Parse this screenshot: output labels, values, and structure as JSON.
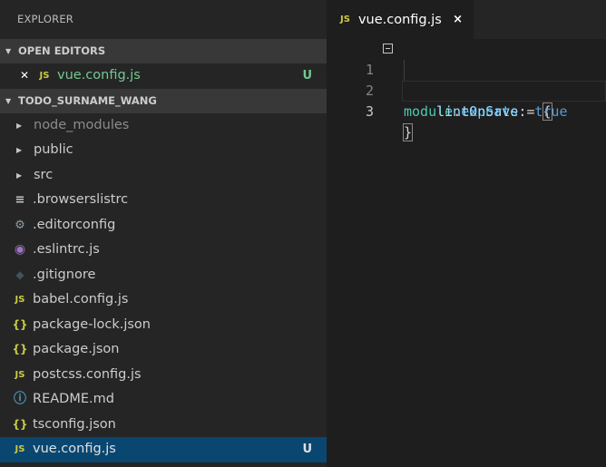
{
  "sidebar": {
    "title": "EXPLORER",
    "open_editors": {
      "label": "OPEN EDITORS",
      "items": [
        {
          "icon": "JS",
          "name": "vue.config.js",
          "badge": "U"
        }
      ]
    },
    "project": {
      "label": "TODO_SURNAME_WANG",
      "folders": [
        {
          "name": "node_modules"
        },
        {
          "name": "public"
        },
        {
          "name": "src"
        }
      ],
      "files": [
        {
          "icon": "≡",
          "name": ".browserslistrc"
        },
        {
          "icon": "⚙",
          "name": ".editorconfig"
        },
        {
          "icon": "◉",
          "name": ".eslintrc.js"
        },
        {
          "icon": "◆",
          "name": ".gitignore"
        },
        {
          "icon": "JS",
          "name": "babel.config.js"
        },
        {
          "icon": "{}",
          "name": "package-lock.json"
        },
        {
          "icon": "{}",
          "name": "package.json"
        },
        {
          "icon": "JS",
          "name": "postcss.config.js"
        },
        {
          "icon": "ⓘ",
          "name": "README.md"
        },
        {
          "icon": "{}",
          "name": "tsconfig.json"
        },
        {
          "icon": "JS",
          "name": "vue.config.js",
          "badge": "U"
        }
      ]
    }
  },
  "tab": {
    "icon": "JS",
    "label": "vue.config.js",
    "close": "×"
  },
  "editor": {
    "lines": [
      {
        "number": "1",
        "t1": "module",
        "t2": ".",
        "t3": "exports",
        "t4": " = ",
        "t5": "{"
      },
      {
        "number": "2",
        "key": "lintOnSave",
        "sep": ": ",
        "val": "true"
      },
      {
        "number": "3",
        "t1": "}"
      }
    ]
  },
  "colors": {
    "accent_selection": "#094771",
    "untracked": "#73c991",
    "js_icon": "#cbcb41"
  }
}
